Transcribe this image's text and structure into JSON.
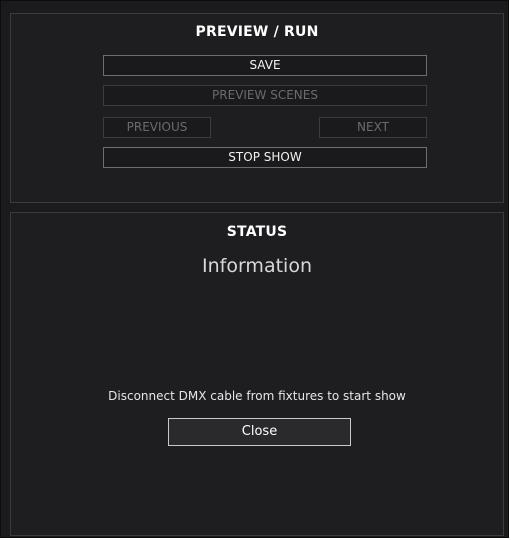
{
  "preview_panel": {
    "title": "PREVIEW / RUN",
    "save_label": "SAVE",
    "preview_scenes_label": "PREVIEW SCENES",
    "previous_label": "PREVIOUS",
    "next_label": "NEXT",
    "stop_show_label": "STOP SHOW"
  },
  "status_panel": {
    "title": "STATUS",
    "heading": "Information",
    "message": "Disconnect DMX cable from fixtures to start show",
    "close_label": "Close"
  },
  "colors": {
    "background": "#1b1b1d",
    "panel": "#1e1e20",
    "border": "#3b3b3e",
    "text": "#ffffff",
    "disabled_text": "#6b6b6e"
  }
}
